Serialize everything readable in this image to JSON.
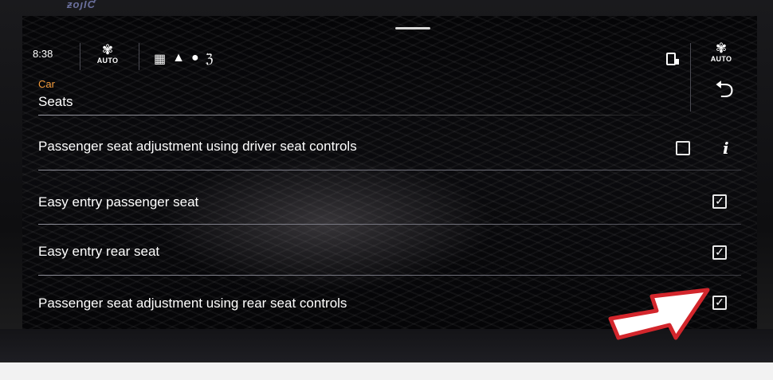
{
  "bezel": {
    "label": "ƶоȷƖƇ"
  },
  "status": {
    "time": "8:38",
    "fan_left": {
      "icon": "fan-icon",
      "label": "AUTO"
    },
    "fan_right": {
      "icon": "fan-icon",
      "label": "AUTO"
    },
    "hvac_icons": [
      "windscreen-demist-icon",
      "seat-icon",
      "recirculation-icon",
      "airflow-icon"
    ],
    "phone_icon": "phone-mirror-icon"
  },
  "header": {
    "breadcrumb": "Car",
    "title": "Seats",
    "back_icon": "return-arrow-icon"
  },
  "settings": [
    {
      "label": "Passenger seat adjustment using driver seat controls",
      "checked": false,
      "has_info": true
    },
    {
      "label": "Easy entry passenger seat",
      "checked": true,
      "has_info": false
    },
    {
      "label": "Easy entry rear seat",
      "checked": true,
      "has_info": false
    },
    {
      "label": "Passenger seat adjustment using rear seat controls",
      "checked": true,
      "has_info": false
    }
  ],
  "colors": {
    "accent": "#f29a3a",
    "arrow_fill": "#ffffff",
    "arrow_border": "#d3262c"
  }
}
